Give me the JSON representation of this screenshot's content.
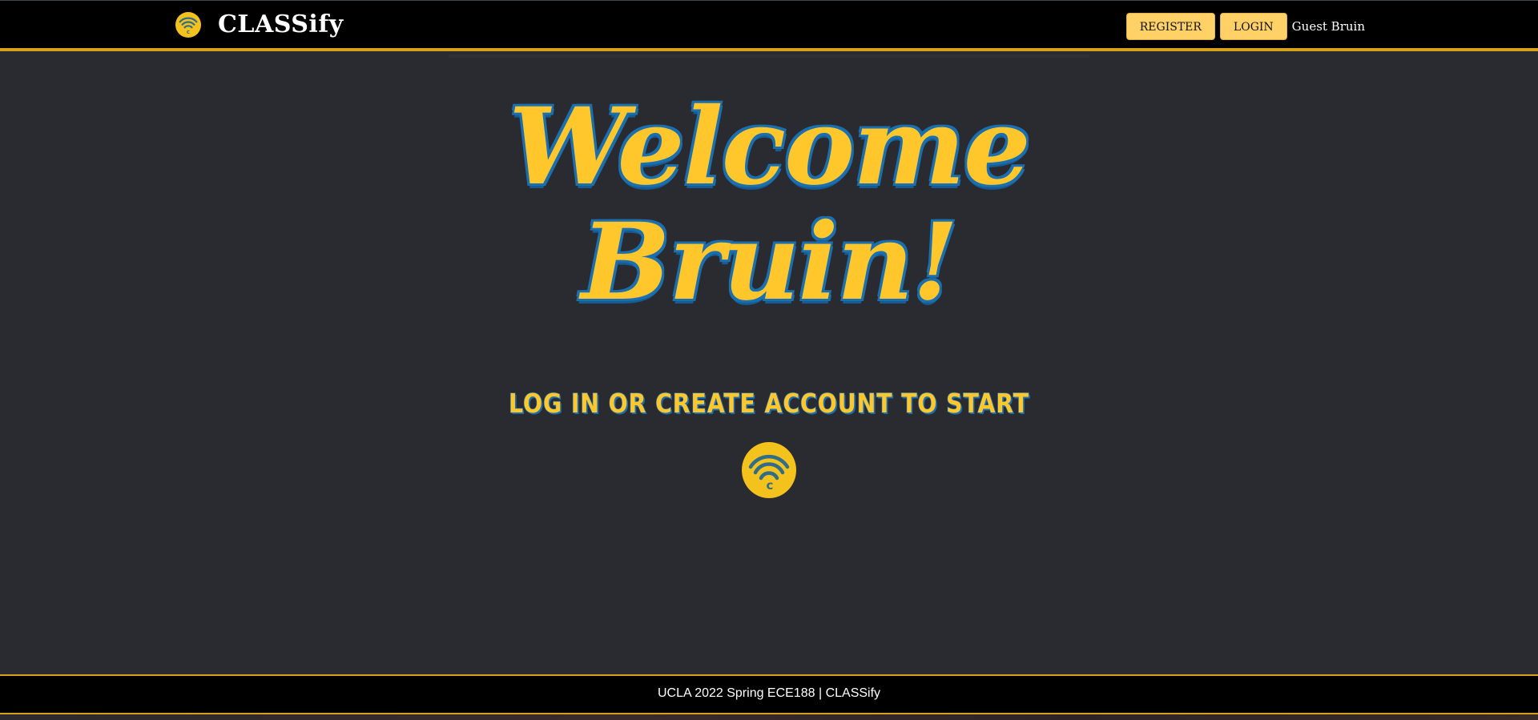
{
  "header": {
    "app_title": "CLASSify",
    "logo_icon": "classify-wifi-c-logo-icon",
    "register_label": "REGISTER",
    "login_label": "LOGIN",
    "user_label": "Guest Bruin"
  },
  "hero": {
    "welcome_line1": "Welcome",
    "welcome_line2": "Bruin!",
    "subtitle": "LOG IN OR CREATE ACCOUNT TO START",
    "center_icon": "classify-wifi-c-logo-icon"
  },
  "footer": {
    "text": "UCLA 2022 Spring ECE188 | CLASSify"
  },
  "colors": {
    "background": "#2a2b30",
    "header_bg": "#000000",
    "accent_gold": "#d6a21a",
    "button_bg": "#ffd166",
    "welcome_fill": "#ffc72c",
    "welcome_stroke": "#1a6fb0"
  }
}
